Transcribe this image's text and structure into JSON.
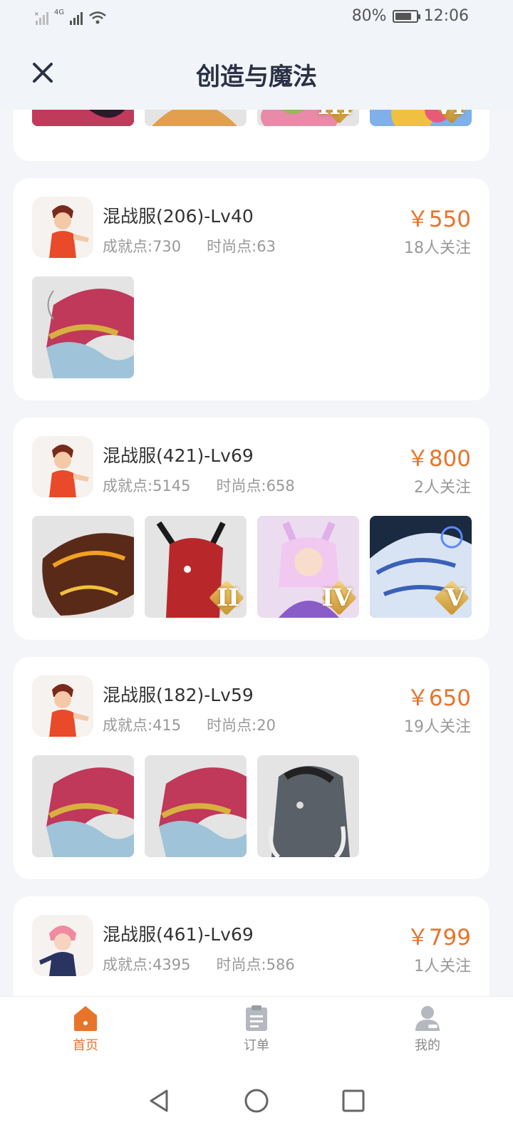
{
  "status_bar": {
    "network_label": "4G",
    "battery_text": "80%",
    "battery_level": 0.8,
    "time": "12:06"
  },
  "header": {
    "title": "创造与魔法",
    "close_icon": "close-icon"
  },
  "listings": [
    {
      "server": "混战服(206)-Lv40",
      "achievement": "成就点:730",
      "fashion": "时尚点:63",
      "price": "￥550",
      "followers": "18人关注",
      "pets": [
        {
          "name": "red-gold-dragon",
          "tier": ""
        }
      ]
    },
    {
      "server": "混战服(421)-Lv69",
      "achievement": "成就点:5145",
      "fashion": "时尚点:658",
      "price": "￥800",
      "followers": "2人关注",
      "pets": [
        {
          "name": "fire-dragon",
          "tier": ""
        },
        {
          "name": "red-deer",
          "tier": "II"
        },
        {
          "name": "fox-maiden",
          "tier": "IV"
        },
        {
          "name": "ice-tiger",
          "tier": "V"
        }
      ]
    },
    {
      "server": "混战服(182)-Lv59",
      "achievement": "成就点:415",
      "fashion": "时尚点:20",
      "price": "￥650",
      "followers": "19人关注",
      "pets": [
        {
          "name": "red-gold-dragon",
          "tier": ""
        },
        {
          "name": "red-gold-dragon",
          "tier": ""
        },
        {
          "name": "mammoth",
          "tier": ""
        }
      ]
    },
    {
      "server": "混战服(461)-Lv69",
      "achievement": "成就点:4395",
      "fashion": "时尚点:586",
      "price": "￥799",
      "followers": "1人关注",
      "pets": []
    }
  ],
  "partial_top_card_tiers": [
    "",
    "",
    "III",
    "VI"
  ],
  "tab_bar": [
    {
      "label": "首页",
      "icon": "home-icon",
      "active": true
    },
    {
      "label": "订单",
      "icon": "order-clipboard-icon",
      "active": false
    },
    {
      "label": "我的",
      "icon": "user-profile-icon",
      "active": false
    }
  ],
  "colors": {
    "accent": "#e8742a",
    "title": "#2b3145",
    "background": "#f3f5f8"
  }
}
